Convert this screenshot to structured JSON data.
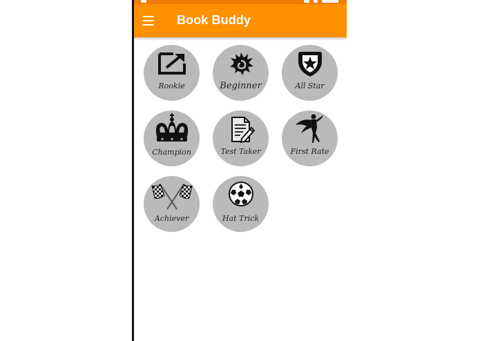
{
  "app": {
    "title": "Book Buddy",
    "bar_color": "#ff9000",
    "menu_icon": "hamburger-menu-icon"
  },
  "badges": [
    {
      "label": "Rookie",
      "icon": "external-link-box-icon"
    },
    {
      "label": "Beginner",
      "icon": "swirl-emblem-icon"
    },
    {
      "label": "All Star",
      "icon": "star-shield-icon"
    },
    {
      "label": "Champion",
      "icon": "crown-icon"
    },
    {
      "label": "Test Taker",
      "icon": "document-pencil-icon"
    },
    {
      "label": "First Rate",
      "icon": "flying-hero-icon"
    },
    {
      "label": "Achiever",
      "icon": "checkered-flags-icon"
    },
    {
      "label": "Hat Trick",
      "icon": "soccer-ball-icon"
    }
  ]
}
